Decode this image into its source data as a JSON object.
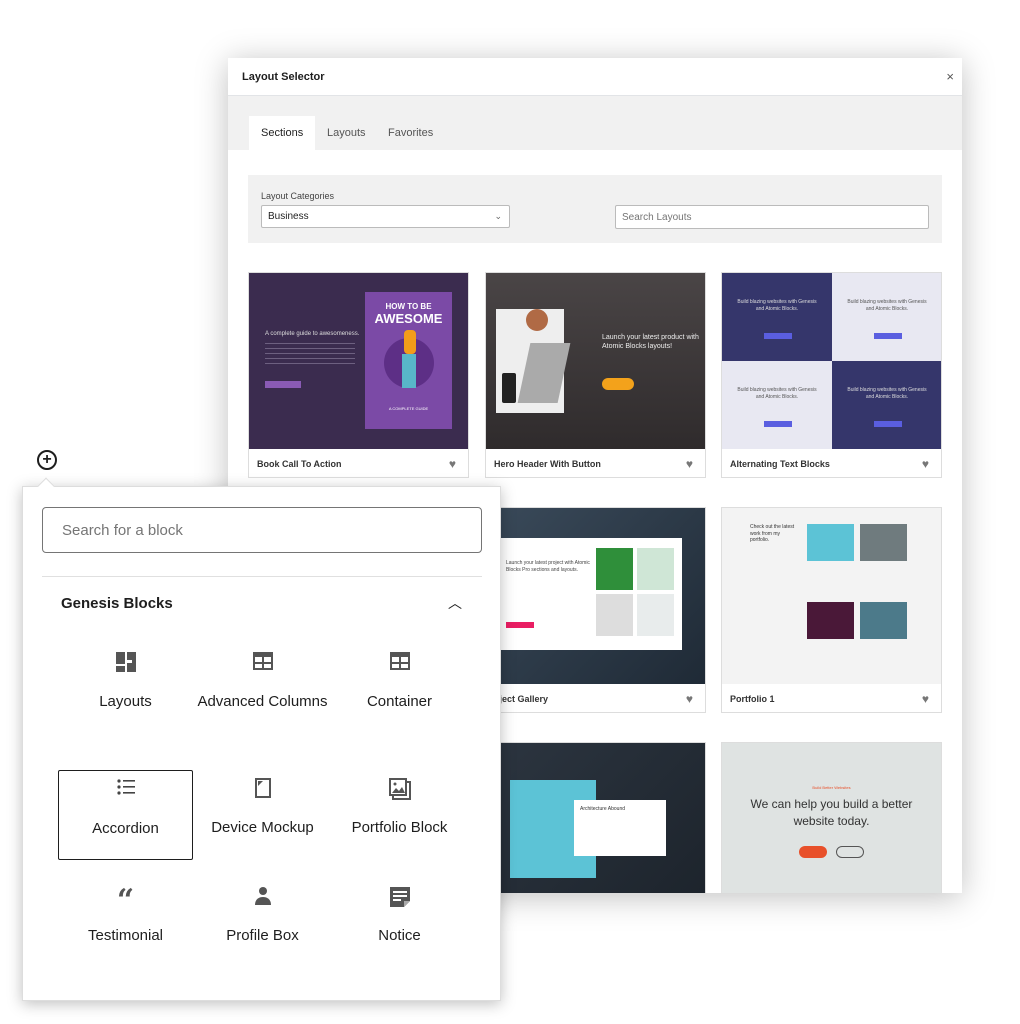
{
  "layout_selector": {
    "title": "Layout Selector",
    "close": "×",
    "tabs": [
      {
        "label": "Sections",
        "active": true
      },
      {
        "label": "Layouts"
      },
      {
        "label": "Favorites"
      }
    ],
    "categories_label": "Layout Categories",
    "category_value": "Business",
    "search_placeholder": "Search Layouts",
    "cards": [
      {
        "title": "Book Call To Action",
        "thumb_heading": "HOW TO BE",
        "thumb_heading2": "AWESOME",
        "thumb_text": "A complete guide to awesomeness.",
        "thumb_footer": "A COMPLETE GUIDE"
      },
      {
        "title": "Hero Header With Button",
        "thumb_text": "Launch your latest product with Atomic Blocks layouts!"
      },
      {
        "title": "Alternating Text Blocks",
        "thumb_text": "Build blazing websites with Genesis and Atomic Blocks."
      },
      {
        "title": "oject Gallery",
        "thumb_text": "Launch your latest project with Atomic Blocks Pro sections and layouts."
      },
      {
        "title": "Portfolio 1",
        "thumb_text": "Check out the latest work from my portfolio."
      },
      {
        "title": "",
        "thumb_text": "Architecture Abound"
      },
      {
        "title": "",
        "thumb_kicker": "Build Better Websites",
        "thumb_text": "We can help you build a better website today."
      }
    ],
    "favorite_icon": "heart-icon"
  },
  "block_inserter": {
    "search_placeholder": "Search for a block",
    "category": "Genesis Blocks",
    "blocks": [
      {
        "label": "Layouts",
        "icon": "layouts-icon"
      },
      {
        "label": "Advanced Columns",
        "icon": "columns-icon"
      },
      {
        "label": "Container",
        "icon": "container-icon"
      },
      {
        "label": "Accordion",
        "icon": "list-icon",
        "selected": true
      },
      {
        "label": "Device Mockup",
        "icon": "device-icon"
      },
      {
        "label": "Portfolio Block",
        "icon": "gallery-icon"
      },
      {
        "label": "Testimonial",
        "icon": "quote-icon"
      },
      {
        "label": "Profile Box",
        "icon": "person-icon"
      },
      {
        "label": "Notice",
        "icon": "notice-icon"
      }
    ]
  },
  "colors": {
    "book_bg": "#3b2c4f",
    "book_cover": "#7b4aa6",
    "alt_dark": "#35366b",
    "alt_light": "#e8e8f2",
    "cta_orange": "#f3a21b"
  }
}
